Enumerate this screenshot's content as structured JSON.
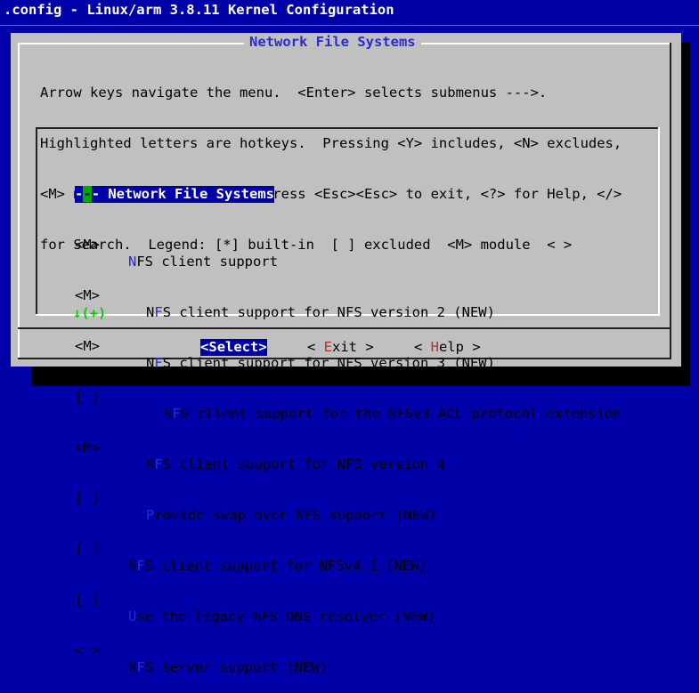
{
  "window_title": ".config - Linux/arm 3.8.11 Kernel Configuration",
  "dialog": {
    "title": "Network File Systems",
    "help_lines": [
      "Arrow keys navigate the menu.  <Enter> selects submenus --->.",
      "Highlighted letters are hotkeys.  Pressing <Y> includes, <N> excludes,",
      "<M> modularizes features.  Press <Esc><Esc> to exit, <?> for Help, </>",
      "for Search.  Legend: [*] built-in  [ ] excluded  <M> module  < >"
    ],
    "items": [
      {
        "state": "",
        "indent": "",
        "hotkey": "",
        "rest": "",
        "prefix": "--",
        "suffix": "- Network File Systems"
      },
      {
        "state": "<M>",
        "indent": "",
        "hotkey": "N",
        "pre": "",
        "rest": "FS client support"
      },
      {
        "state": "<M>",
        "indent": "  ",
        "hotkey": "F",
        "pre": "N",
        "rest": "S client support for NFS version 2 (NEW)"
      },
      {
        "state": "<M>",
        "indent": "  ",
        "hotkey": "F",
        "pre": "N",
        "rest": "S client support for NFS version 3 (NEW)"
      },
      {
        "state": "[ ]",
        "indent": "    ",
        "hotkey": "F",
        "pre": "N",
        "rest": "S client support for the NFSv3 ACL protocol extension"
      },
      {
        "state": "<M>",
        "indent": "  ",
        "hotkey": "F",
        "pre": "N",
        "rest": "S client support for NFS version 4"
      },
      {
        "state": "[ ]",
        "indent": "  ",
        "hotkey": "P",
        "pre": "",
        "rest": "rovide swap over NFS support (NEW)"
      },
      {
        "state": "[ ]",
        "indent": "",
        "hotkey": "F",
        "pre": "N",
        "rest": "S client support for NFSv4.1 (NEW)"
      },
      {
        "state": "[ ]",
        "indent": "",
        "hotkey": "U",
        "pre": "",
        "rest": "se the legacy NFS DNS resolver (NEW)"
      },
      {
        "state": "< >",
        "indent": "",
        "hotkey": "F",
        "pre": "N",
        "rest": "S server support (NEW)"
      }
    ],
    "more_indicator": "↓(+)",
    "buttons": {
      "select": {
        "open": "<",
        "hotkey": "S",
        "rest": "elect",
        "close": ">"
      },
      "exit": {
        "open": "< ",
        "hotkey": "E",
        "rest": "xit",
        "close": " >"
      },
      "help": {
        "open": "< ",
        "hotkey": "H",
        "rest": "elp",
        "close": " >"
      }
    }
  },
  "colors": {
    "background": "#0000a8",
    "dialog": "#c0c0c0",
    "hotkey": "#2b2bd4",
    "button_hotkey": "#b03030",
    "selection": "#0000a8",
    "cursor": "#00a800"
  }
}
